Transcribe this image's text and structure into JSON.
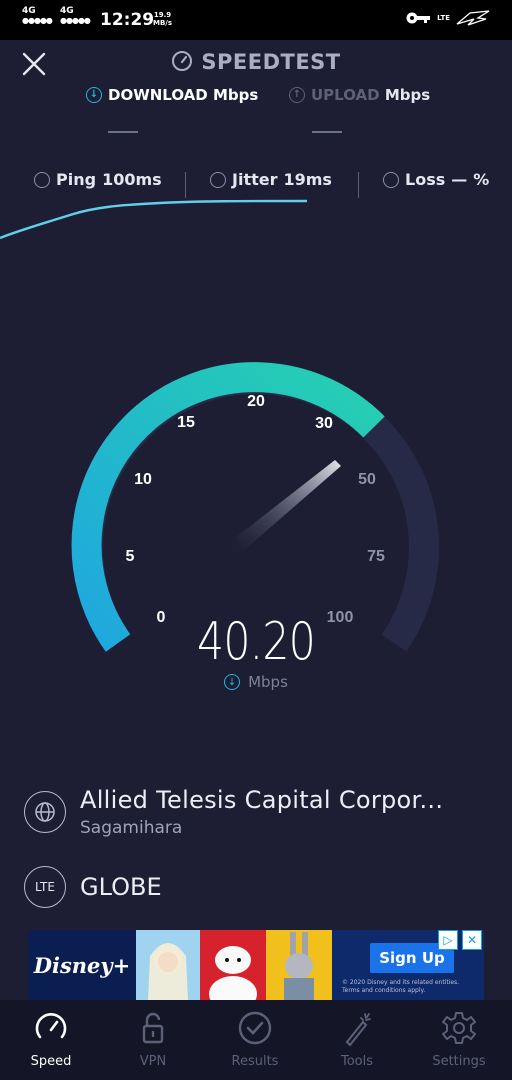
{
  "status_bar": {
    "net1": "4G",
    "net2": "4G",
    "time": "12:29",
    "speed_value": "19.9",
    "speed_unit": "MB/s",
    "lte": "LTE"
  },
  "header": {
    "title": "SPEEDTEST",
    "download_label": "DOWNLOAD",
    "upload_label": "UPLOAD",
    "unit": "Mbps",
    "download_value": "—",
    "upload_value": "—"
  },
  "stats": {
    "ping_label": "Ping",
    "ping_value": "100ms",
    "jitter_label": "Jitter",
    "jitter_value": "19ms",
    "loss_label": "Loss",
    "loss_value": "—",
    "loss_unit": "%"
  },
  "gauge": {
    "ticks": [
      "0",
      "5",
      "10",
      "15",
      "20",
      "30",
      "50",
      "75",
      "100"
    ],
    "reading": "40.20",
    "unit": "Mbps",
    "accent": "#1fb8d8",
    "accent2": "#26d0b0"
  },
  "server": {
    "provider": "Allied Telesis Capital Corpor...",
    "location": "Sagamihara"
  },
  "carrier": {
    "badge": "LTE",
    "name": "GLOBE"
  },
  "ad": {
    "brand": "Disney+",
    "cta": "Sign Up",
    "fine_print_1": "© 2020 Disney and its related entities.",
    "fine_print_2": "Terms and conditions apply."
  },
  "nav": {
    "items": [
      {
        "label": "Speed",
        "icon": "speed-icon",
        "active": true
      },
      {
        "label": "VPN",
        "icon": "lock-icon",
        "active": false
      },
      {
        "label": "Results",
        "icon": "check-icon",
        "active": false
      },
      {
        "label": "Tools",
        "icon": "wand-icon",
        "active": false
      },
      {
        "label": "Settings",
        "icon": "gear-icon",
        "active": false
      }
    ]
  }
}
